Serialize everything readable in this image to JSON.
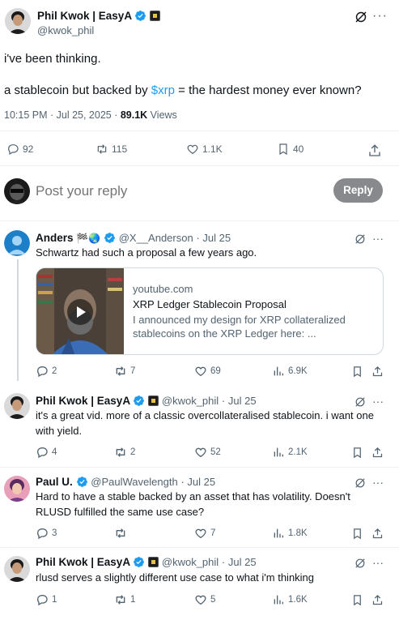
{
  "main_tweet": {
    "author_name": "Phil Kwok | EasyA",
    "author_handle": "@kwok_phil",
    "line1": "i've been thinking.",
    "line2_pre": "a stablecoin but backed by ",
    "line2_link": "$xrp",
    "line2_post": " = the hardest money ever known?",
    "timestamp": "10:15 PM · Jul 25, 2025 · ",
    "views_count": "89.1K",
    "views_label": " Views",
    "replies": "92",
    "reposts": "115",
    "likes": "1.1K",
    "bookmarks": "40"
  },
  "composer": {
    "placeholder": "Post your reply",
    "button_label": "Reply"
  },
  "replies": [
    {
      "author_name": "Anders",
      "author_handle": "@X__Anderson",
      "time": "· Jul 25",
      "text": "Schwartz had such a proposal a few years ago.",
      "card": {
        "domain": "youtube.com",
        "title": "XRP Ledger Stablecoin Proposal",
        "description": "I announced my design for XRP collateralized stablecoins on the XRP Ledger here: ..."
      },
      "replies": "2",
      "reposts": "7",
      "likes": "69",
      "views": "6.9K"
    },
    {
      "author_name": "Phil Kwok | EasyA",
      "author_handle": "@kwok_phil",
      "time": "· Jul 25",
      "text": "it's a great vid. more of a classic overcollateralised stablecoin. i want one with yield.",
      "replies": "4",
      "reposts": "2",
      "likes": "52",
      "views": "2.1K"
    },
    {
      "author_name": "Paul U.",
      "author_handle": "@PaulWavelength",
      "time": "· Jul 25",
      "text": "Hard to have a stable backed by an asset that has volatility. Doesn't RLUSD fulfilled the same use case?",
      "replies": "3",
      "reposts": "",
      "likes": "7",
      "views": "1.8K"
    },
    {
      "author_name": "Phil Kwok | EasyA",
      "author_handle": "@kwok_phil",
      "time": "· Jul 25",
      "text": "rlusd serves a slightly different use case to what i'm thinking",
      "replies": "1",
      "reposts": "1",
      "likes": "5",
      "views": "1.6K"
    }
  ],
  "colors": {
    "accent": "#1d9bf0",
    "muted": "#536471",
    "reply_button": "#87898c"
  }
}
